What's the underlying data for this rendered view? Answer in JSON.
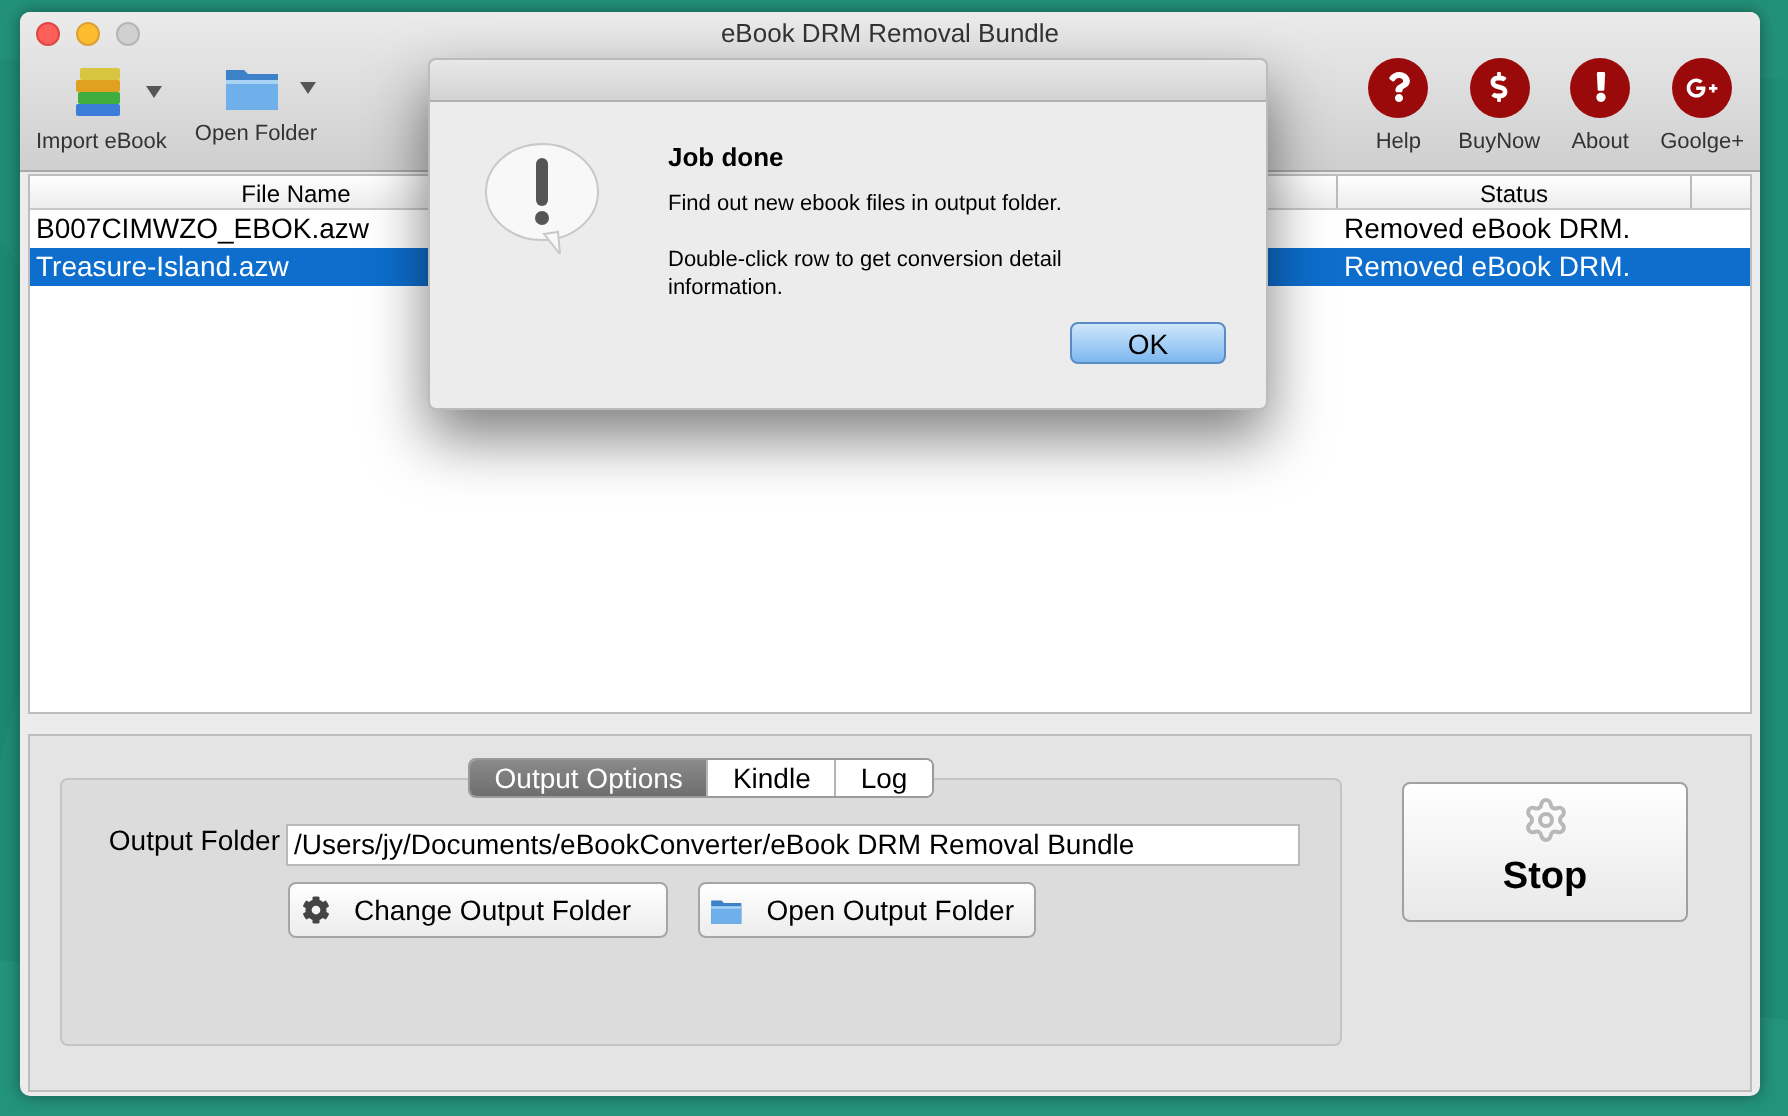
{
  "window": {
    "title": "eBook DRM Removal Bundle"
  },
  "toolbar": {
    "left": [
      {
        "label": "Import eBook",
        "kind": "books"
      },
      {
        "label": "Open Folder",
        "kind": "folder"
      }
    ],
    "right": [
      {
        "label": "Help",
        "kind": "question"
      },
      {
        "label": "BuyNow",
        "kind": "dollar"
      },
      {
        "label": "About",
        "kind": "exclamation"
      },
      {
        "label": "Goolge+",
        "kind": "gplus"
      }
    ]
  },
  "table": {
    "columns": [
      "File Name",
      "Status"
    ],
    "rows": [
      {
        "file": "B007CIMWZO_EBOK.azw",
        "status": "Removed eBook DRM.",
        "selected": false
      },
      {
        "file": "Treasure-Island.azw",
        "status": "Removed eBook DRM.",
        "selected": true
      }
    ]
  },
  "options": {
    "tabs": [
      {
        "label": "Output Options",
        "selected": true
      },
      {
        "label": "Kindle",
        "selected": false
      },
      {
        "label": "Log",
        "selected": false
      }
    ],
    "output_folder": {
      "label": "Output Folder",
      "value": "/Users/jy/Documents/eBookConverter/eBook DRM Removal Bundle"
    },
    "buttons": [
      {
        "label": "Change Output Folder",
        "kind": "gear"
      },
      {
        "label": "Open Output Folder",
        "kind": "folder"
      }
    ]
  },
  "stop_button": {
    "label": "Stop"
  },
  "dialog": {
    "title": "Job done",
    "messages": [
      "Find out new ebook files in output folder.",
      "Double-click row to get conversion detail information."
    ],
    "button": "OK"
  }
}
